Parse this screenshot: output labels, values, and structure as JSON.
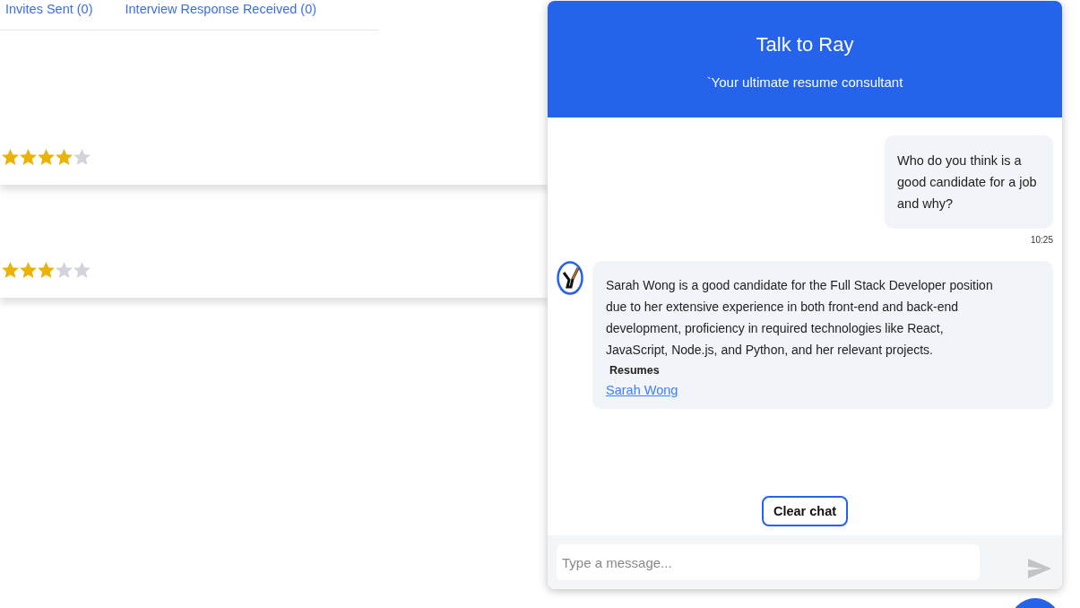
{
  "tabs": [
    {
      "label": "Invites Sent (0)"
    },
    {
      "label": "Interview Response Received (0)"
    }
  ],
  "candidates": [
    {
      "stars": 4
    },
    {
      "stars": 3
    }
  ],
  "chat": {
    "title": "Talk to Ray",
    "subtitle": "`Your ultimate resume consultant",
    "messages": [
      {
        "kind": "user",
        "text": "Who do you think is a good candidate for a job and why?",
        "time": "10:25"
      },
      {
        "kind": "bot",
        "text": "Sarah Wong is a good candidate for the Full Stack Developer position due to her extensive experience in both front-end and back-end development, proficiency in required technologies like React, JavaScript, Node.js, and Python, and her relevant projects.",
        "section": "Resumes",
        "links": [
          "Sarah Wong"
        ]
      }
    ],
    "clear_button": "Clear chat",
    "input": {
      "placeholder": "Type a message..."
    }
  }
}
